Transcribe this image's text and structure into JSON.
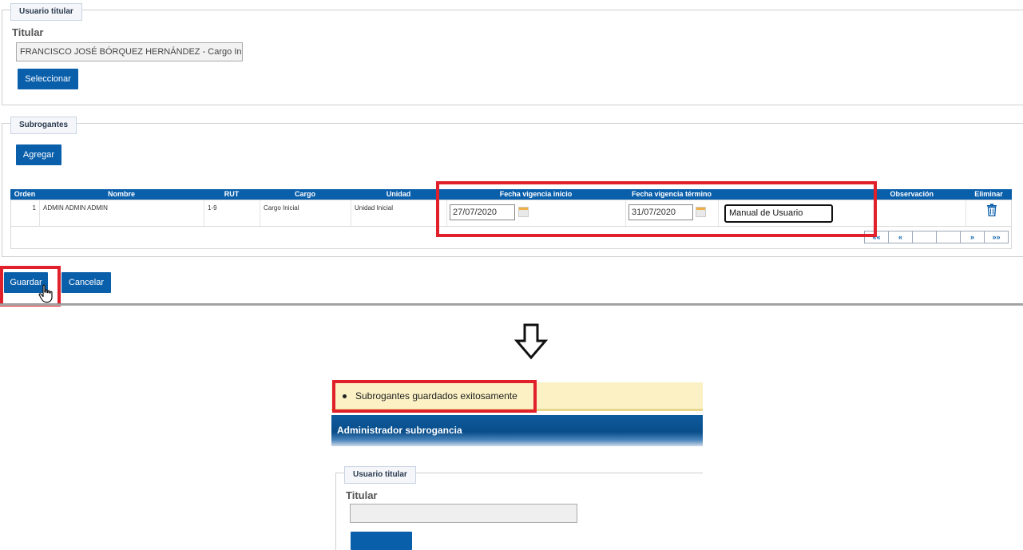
{
  "top": {
    "usuario_titular_legend": "Usuario titular",
    "titular_label": "Titular",
    "titular_value": "FRANCISCO JOSÉ BÓRQUEZ HERNÁNDEZ - Cargo Ini",
    "seleccionar_label": "Seleccionar",
    "subrogantes_legend": "Subrogantes",
    "agregar_label": "Agregar",
    "table": {
      "headers": [
        "Orden",
        "Nombre",
        "RUT",
        "Cargo",
        "Unidad",
        "Fecha vigencia inicio",
        "Fecha vigencia término",
        "Observación",
        "Eliminar"
      ],
      "rows": [
        {
          "orden": "1",
          "nombre": "ADMIN ADMIN ADMIN",
          "rut": "1-9",
          "cargo": "Cargo Inicial",
          "unidad": "Unidad Inicial",
          "fecha_inicio": "27/07/2020",
          "fecha_termino": "31/07/2020",
          "observacion": "Manual de Usuario"
        }
      ],
      "pager": [
        "««",
        "«",
        "",
        "",
        "»",
        "»»"
      ]
    },
    "guardar_label": "Guardar",
    "cancelar_label": "Cancelar"
  },
  "bottom": {
    "success_message": "Subrogantes guardados exitosamente",
    "banner_title": "Administrador subrogancia",
    "usuario_titular_legend": "Usuario titular",
    "titular_label": "Titular",
    "titular_value": ""
  },
  "colors": {
    "primary": "#0a5fab",
    "highlight": "#e0202a",
    "notice_bg": "#fbf1c4"
  },
  "icons": {
    "calendar": "calendar-icon",
    "trash": "trash-icon",
    "cursor": "hand-cursor-icon",
    "arrow": "arrow-down-icon"
  }
}
